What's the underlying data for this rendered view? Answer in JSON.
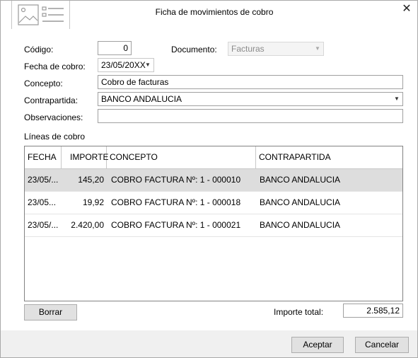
{
  "window": {
    "title": "Ficha de movimientos de cobro",
    "close_glyph": "✕"
  },
  "form": {
    "codigo": {
      "label": "Código:",
      "value": "0"
    },
    "documento": {
      "label": "Documento:",
      "value": "Facturas"
    },
    "fecha": {
      "label": "Fecha de cobro:",
      "value": "23/05/20XX"
    },
    "concepto": {
      "label": "Concepto:",
      "value": "Cobro de facturas"
    },
    "contrapartida": {
      "label": "Contrapartida:",
      "value": "BANCO ANDALUCIA"
    },
    "observaciones": {
      "label": "Observaciones:",
      "value": ""
    }
  },
  "lines": {
    "title": "Líneas de cobro",
    "columns": [
      "FECHA",
      "IMPORTE",
      "CONCEPTO",
      "CONTRAPARTIDA"
    ],
    "rows": [
      {
        "fecha": "23/05/...",
        "importe": "145,20",
        "concepto": "COBRO FACTURA Nº: 1 - 000010",
        "contrapartida": "BANCO ANDALUCIA",
        "selected": true
      },
      {
        "fecha": "23/05...",
        "importe": "19,92",
        "concepto": "COBRO FACTURA Nº: 1 - 000018",
        "contrapartida": "BANCO ANDALUCIA",
        "selected": false
      },
      {
        "fecha": "23/05/...",
        "importe": "2.420,00",
        "concepto": "COBRO FACTURA Nº: 1 - 000021",
        "contrapartida": "BANCO ANDALUCIA",
        "selected": false
      }
    ]
  },
  "actions": {
    "borrar": "Borrar",
    "total_label": "Importe total:",
    "total_value": "2.585,12",
    "aceptar": "Aceptar",
    "cancelar": "Cancelar"
  },
  "colors": {
    "selected_row": "#dddddd",
    "footer_bg": "#f0f0f0"
  }
}
